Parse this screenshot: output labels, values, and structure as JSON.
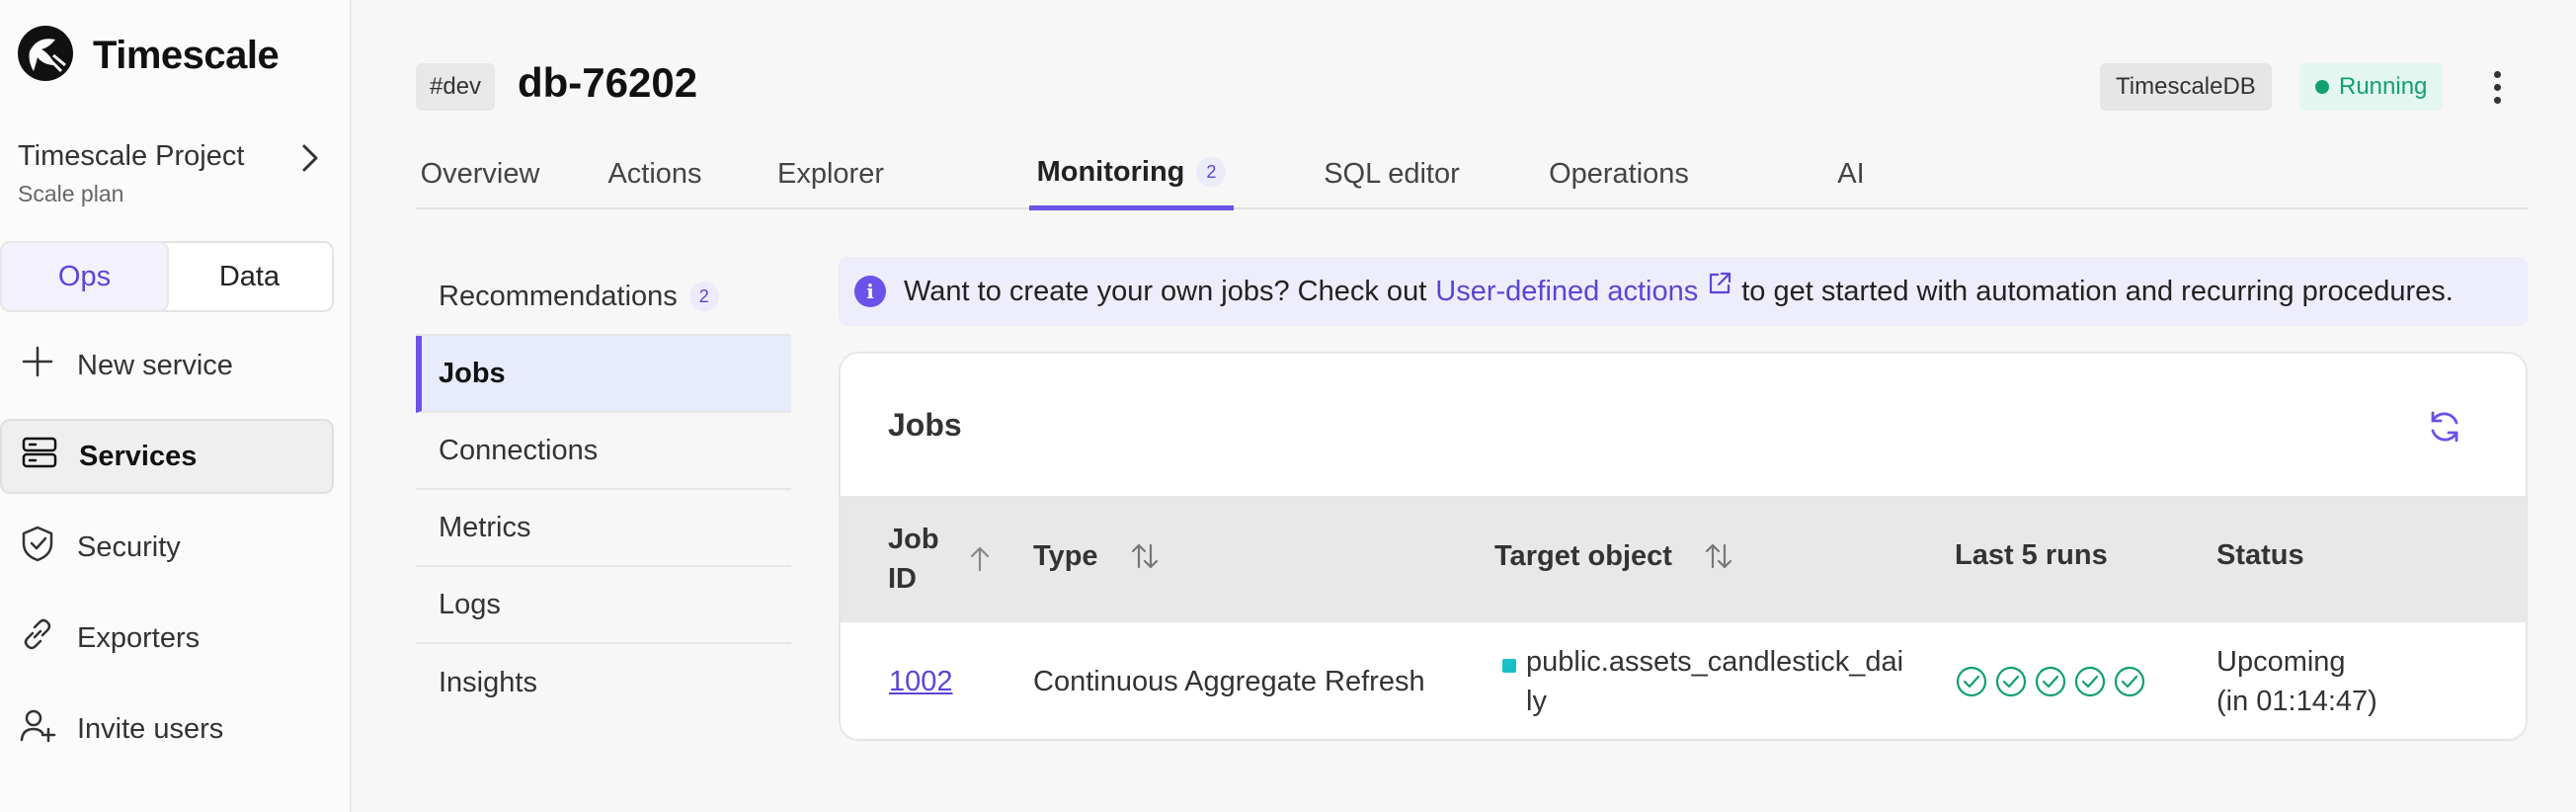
{
  "brand": {
    "name": "Timescale"
  },
  "project": {
    "name": "Timescale Project",
    "plan": "Scale plan"
  },
  "segment": {
    "options": [
      "Ops",
      "Data"
    ],
    "selected": "Ops"
  },
  "sidebar": {
    "items": [
      {
        "label": "New service",
        "icon": "plus-icon"
      },
      {
        "label": "Services",
        "icon": "server-icon",
        "active": true
      },
      {
        "label": "Security",
        "icon": "shield-check-icon"
      },
      {
        "label": "Exporters",
        "icon": "link-icon"
      },
      {
        "label": "Invite users",
        "icon": "user-plus-icon"
      }
    ]
  },
  "header": {
    "env_tag": "#dev",
    "service_name": "db-76202",
    "engine": "TimescaleDB",
    "status": "Running"
  },
  "tabs": [
    {
      "label": "Overview"
    },
    {
      "label": "Actions"
    },
    {
      "label": "Explorer"
    },
    {
      "label": "Monitoring",
      "badge": "2",
      "active": true
    },
    {
      "label": "SQL editor"
    },
    {
      "label": "Operations"
    },
    {
      "label": "AI"
    }
  ],
  "subnav": [
    {
      "label": "Recommendations",
      "badge": "2"
    },
    {
      "label": "Jobs",
      "active": true
    },
    {
      "label": "Connections"
    },
    {
      "label": "Metrics"
    },
    {
      "label": "Logs"
    },
    {
      "label": "Insights"
    }
  ],
  "banner": {
    "pre": "Want to create your own jobs? Check out",
    "link": "User-defined actions",
    "post": "to get started with automation and recurring procedures."
  },
  "jobs": {
    "title": "Jobs",
    "columns": {
      "job_id_line1": "Job",
      "job_id_line2": "ID",
      "type": "Type",
      "target": "Target object",
      "last_runs": "Last 5 runs",
      "status": "Status"
    },
    "rows": [
      {
        "job_id": "1002",
        "type": "Continuous Aggregate Refresh",
        "target_line1": "public.assets_candlestick_dai",
        "target_line2": "ly",
        "runs": [
          "success",
          "success",
          "success",
          "success",
          "success"
        ],
        "status_line1": "Upcoming",
        "status_line2": "(in 01:14:47)"
      }
    ]
  },
  "colors": {
    "accent": "#6b52e8",
    "running": "#12a06e",
    "run_success": "#12a06e",
    "target_square": "#16c1c8"
  }
}
